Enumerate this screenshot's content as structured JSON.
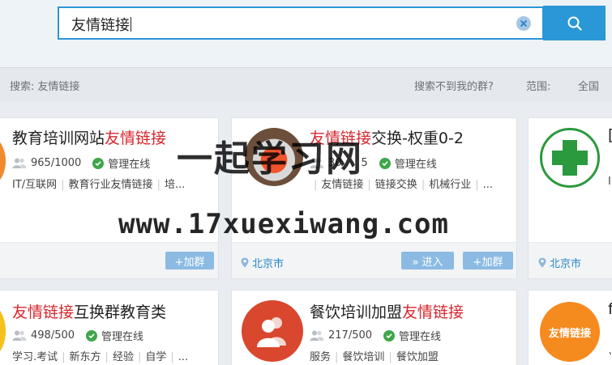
{
  "search": {
    "query": "友情链接"
  },
  "subbar": {
    "prefix": "搜索:",
    "keyword": "友情链接",
    "not_found": "搜索不到我的群?",
    "range_label": "范围:",
    "range_value": "全国"
  },
  "cards": [
    {
      "title_plain": "教育培训网站",
      "title_highlight": "友情链接",
      "members": "965/1000",
      "managed": "管理在线",
      "tags": [
        "IT/互联网",
        "教育行业友情链接",
        "培..."
      ],
      "join_label": "+加群"
    },
    {
      "title_highlight": "友情链接",
      "title_plain": "交换-权重0-2",
      "members": "30",
      "members_tail": "5",
      "managed": "管理在线",
      "tags": [
        "友情链接",
        "链接交换",
        "机械行业",
        "..."
      ],
      "location": "北京市",
      "enter_label": "» 进入",
      "join_label": "+加群"
    },
    {
      "title_plain": "[",
      "tags_tail": "I",
      "location": "北京市"
    },
    {
      "title_highlight": "友情链接",
      "title_plain": "互换群教育类",
      "members": "498/500",
      "managed": "管理在线",
      "tags": [
        "学习.考试",
        "新东方",
        "经验",
        "自学",
        "..."
      ]
    },
    {
      "title_plain": "餐饮培训加盟",
      "title_highlight": "友情链接",
      "members": "217/500",
      "managed": "管理在线",
      "tags": [
        "服务",
        "餐饮培训",
        "餐饮加盟"
      ]
    },
    {
      "avatar_text": "友情链接",
      "title_plain": "f",
      "tags_tail": "⺌"
    }
  ],
  "watermark": {
    "line1": "一起学习网",
    "line2": "www.17xuexiwang.com"
  },
  "colors": {
    "accent": "#2a97d6",
    "highlight": "#d8262d",
    "online": "#3fa64a",
    "button": "#8bbbe3",
    "location": "#2a87c8"
  }
}
